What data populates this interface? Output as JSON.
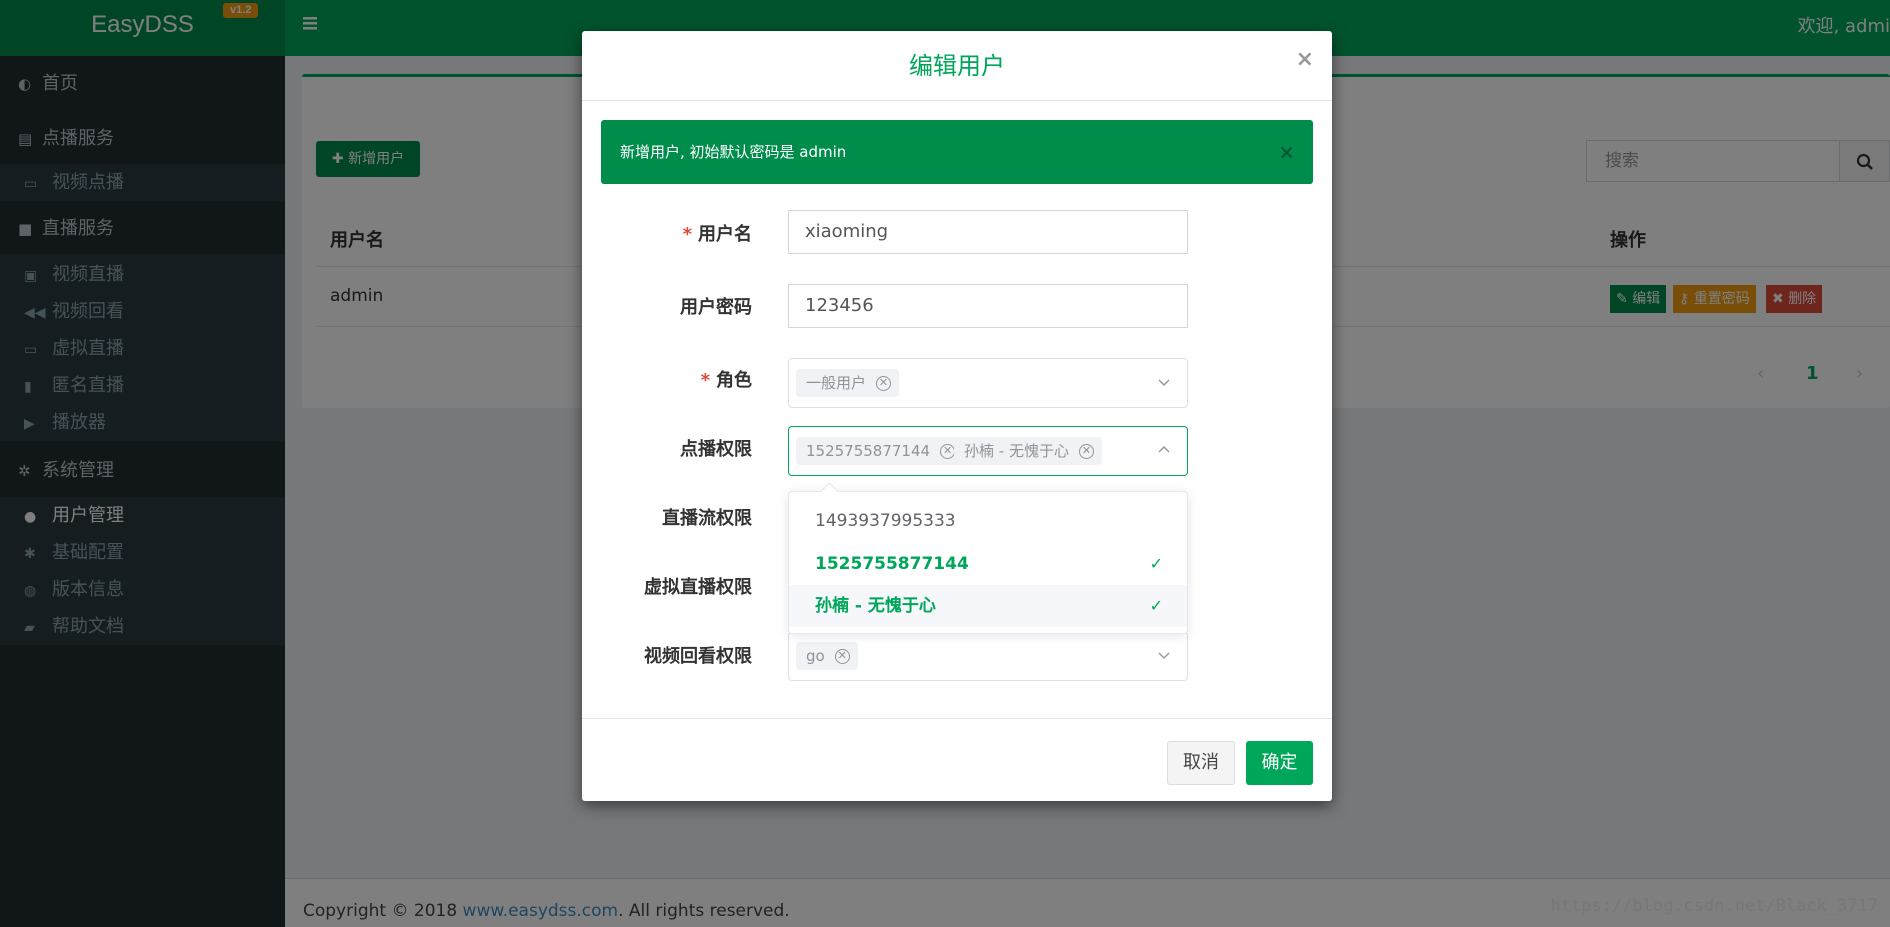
{
  "header": {
    "logo": "EasyDSS",
    "version": "v1.2",
    "welcome": "欢迎, admi"
  },
  "sidebar": {
    "items": [
      {
        "label": "首页",
        "icon": "dashboard-icon"
      },
      {
        "label": "点播服务",
        "icon": "film-icon"
      },
      {
        "label": "视频点播",
        "icon": "monitor-icon"
      },
      {
        "label": "直播服务",
        "icon": "video-camera-icon"
      },
      {
        "label": "视频直播",
        "icon": "play-square-icon"
      },
      {
        "label": "视频回看",
        "icon": "backward-icon"
      },
      {
        "label": "虚拟直播",
        "icon": "laptop-icon"
      },
      {
        "label": "匿名直播",
        "icon": "lock-icon"
      },
      {
        "label": "播放器",
        "icon": "play-circle-icon"
      },
      {
        "label": "系统管理",
        "icon": "cogs-icon"
      },
      {
        "label": "用户管理",
        "icon": "users-icon"
      },
      {
        "label": "基础配置",
        "icon": "gear-icon"
      },
      {
        "label": "版本信息",
        "icon": "globe-icon"
      },
      {
        "label": "帮助文档",
        "icon": "book-icon"
      }
    ]
  },
  "main": {
    "add_button": "新增用户",
    "search_placeholder": "搜索",
    "table": {
      "headers": [
        "用户名",
        "操作"
      ],
      "rows": [
        {
          "username": "admin"
        }
      ],
      "actions": {
        "edit": "编辑",
        "reset": "重置密码",
        "delete": "删除"
      }
    },
    "pager": {
      "prev": "‹",
      "page": "1",
      "next": "›"
    }
  },
  "footer": {
    "prefix": "Copyright © 2018 ",
    "link": "www.easydss.com",
    "suffix": ". All rights reserved."
  },
  "watermark": "https://blog.csdn.net/Black_3717",
  "modal": {
    "title": "编辑用户",
    "close": "×",
    "alert": "新增用户, 初始默认密码是 admin",
    "alert_close": "×",
    "fields": {
      "username": {
        "label": "用户名",
        "value": "xiaoming"
      },
      "password": {
        "label": "用户密码",
        "value": "123456"
      },
      "role": {
        "label": "角色",
        "tags": [
          "一般用户"
        ]
      },
      "vod": {
        "label": "点播权限",
        "tags": [
          "1525755877144",
          "孙楠 - 无愧于心"
        ]
      },
      "live": {
        "label": "直播流权限"
      },
      "virtual": {
        "label": "虚拟直播权限"
      },
      "playback": {
        "label": "视频回看权限",
        "tags": [
          "go"
        ]
      }
    },
    "required_mark": "*",
    "dropdown_options": [
      {
        "label": "1493937995333",
        "selected": false
      },
      {
        "label": "1525755877144",
        "selected": true
      },
      {
        "label": "孙楠 - 无愧于心",
        "selected": true
      }
    ],
    "cancel": "取消",
    "confirm": "确定"
  },
  "colors": {
    "primary": "#00a65a",
    "primary_dark": "#008d4c",
    "sidebar": "#222d32",
    "warning": "#f39c12",
    "danger": "#dd4b39"
  }
}
